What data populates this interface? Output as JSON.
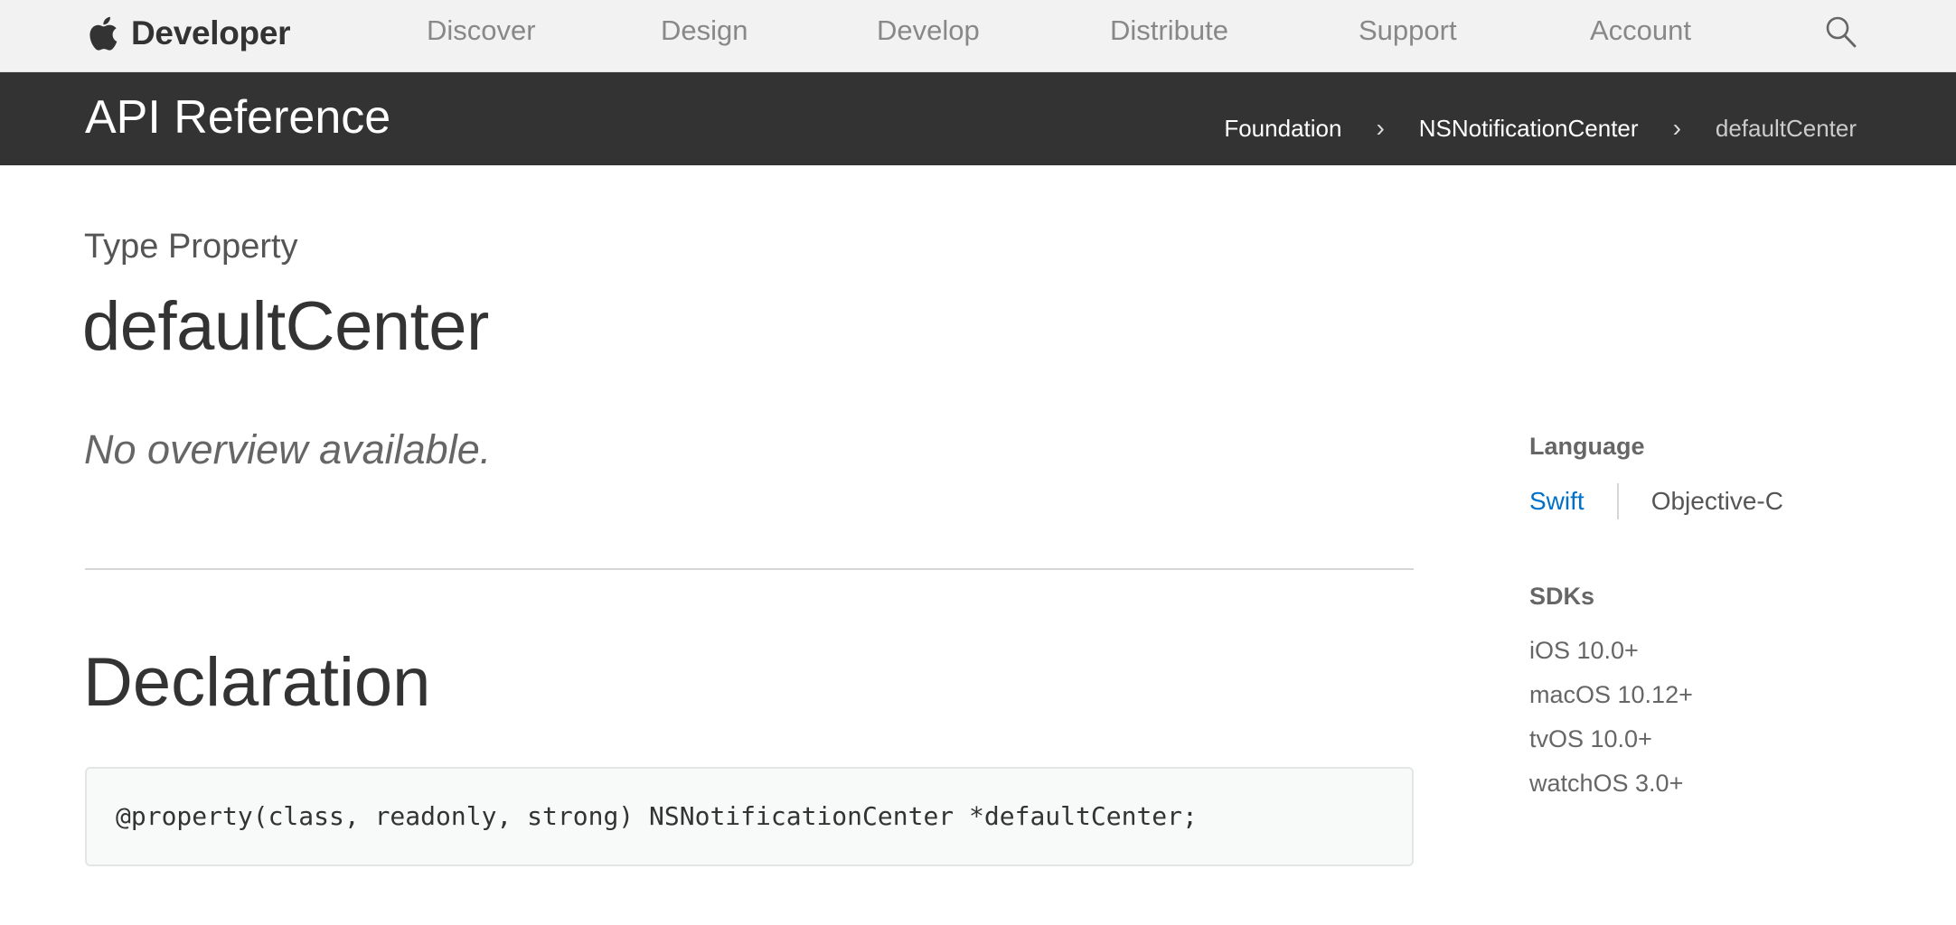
{
  "global_nav": {
    "brand_label": "Developer",
    "items": [
      {
        "label": "Discover"
      },
      {
        "label": "Design"
      },
      {
        "label": "Develop"
      },
      {
        "label": "Distribute"
      },
      {
        "label": "Support"
      },
      {
        "label": "Account"
      }
    ],
    "search_icon": "search-icon",
    "logo_icon": "apple-logo-icon"
  },
  "subheader": {
    "title": "API Reference",
    "breadcrumb": [
      {
        "label": "Foundation"
      },
      {
        "label": "NSNotificationCenter"
      },
      {
        "label": "defaultCenter"
      }
    ],
    "separator": "›"
  },
  "main": {
    "eyebrow": "Type Property",
    "title": "defaultCenter",
    "overview": "No overview available.",
    "declaration_heading": "Declaration",
    "declaration_code": "@property(class, readonly, strong) NSNotificationCenter *defaultCenter;"
  },
  "sidebar": {
    "language_heading": "Language",
    "languages": [
      {
        "label": "Swift",
        "selected": true
      },
      {
        "label": "Objective-C",
        "selected": false
      }
    ],
    "sdks_heading": "SDKs",
    "sdks": [
      {
        "label": "iOS 10.0+"
      },
      {
        "label": "macOS 10.12+"
      },
      {
        "label": "tvOS 10.0+"
      },
      {
        "label": "watchOS 3.0+"
      }
    ]
  },
  "colors": {
    "nav_background": "#f2f2f2",
    "subheader_background": "#333333",
    "link_active": "#0070c9",
    "code_background": "#f8f9f9"
  }
}
